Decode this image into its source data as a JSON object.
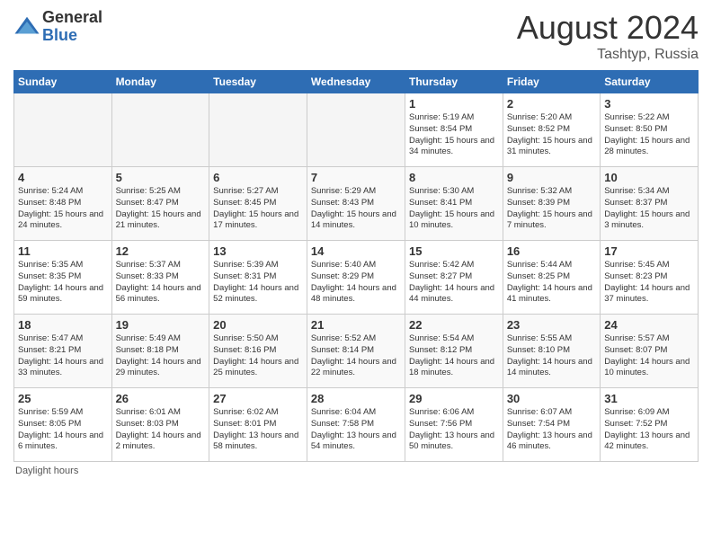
{
  "header": {
    "logo_general": "General",
    "logo_blue": "Blue",
    "month_title": "August 2024",
    "location": "Tashtyp, Russia"
  },
  "days_of_week": [
    "Sunday",
    "Monday",
    "Tuesday",
    "Wednesday",
    "Thursday",
    "Friday",
    "Saturday"
  ],
  "weeks": [
    [
      {
        "num": "",
        "empty": true
      },
      {
        "num": "",
        "empty": true
      },
      {
        "num": "",
        "empty": true
      },
      {
        "num": "",
        "empty": true
      },
      {
        "num": "1",
        "sunrise": "5:19 AM",
        "sunset": "8:54 PM",
        "daylight": "15 hours and 34 minutes."
      },
      {
        "num": "2",
        "sunrise": "5:20 AM",
        "sunset": "8:52 PM",
        "daylight": "15 hours and 31 minutes."
      },
      {
        "num": "3",
        "sunrise": "5:22 AM",
        "sunset": "8:50 PM",
        "daylight": "15 hours and 28 minutes."
      }
    ],
    [
      {
        "num": "4",
        "sunrise": "5:24 AM",
        "sunset": "8:48 PM",
        "daylight": "15 hours and 24 minutes."
      },
      {
        "num": "5",
        "sunrise": "5:25 AM",
        "sunset": "8:47 PM",
        "daylight": "15 hours and 21 minutes."
      },
      {
        "num": "6",
        "sunrise": "5:27 AM",
        "sunset": "8:45 PM",
        "daylight": "15 hours and 17 minutes."
      },
      {
        "num": "7",
        "sunrise": "5:29 AM",
        "sunset": "8:43 PM",
        "daylight": "15 hours and 14 minutes."
      },
      {
        "num": "8",
        "sunrise": "5:30 AM",
        "sunset": "8:41 PM",
        "daylight": "15 hours and 10 minutes."
      },
      {
        "num": "9",
        "sunrise": "5:32 AM",
        "sunset": "8:39 PM",
        "daylight": "15 hours and 7 minutes."
      },
      {
        "num": "10",
        "sunrise": "5:34 AM",
        "sunset": "8:37 PM",
        "daylight": "15 hours and 3 minutes."
      }
    ],
    [
      {
        "num": "11",
        "sunrise": "5:35 AM",
        "sunset": "8:35 PM",
        "daylight": "14 hours and 59 minutes."
      },
      {
        "num": "12",
        "sunrise": "5:37 AM",
        "sunset": "8:33 PM",
        "daylight": "14 hours and 56 minutes."
      },
      {
        "num": "13",
        "sunrise": "5:39 AM",
        "sunset": "8:31 PM",
        "daylight": "14 hours and 52 minutes."
      },
      {
        "num": "14",
        "sunrise": "5:40 AM",
        "sunset": "8:29 PM",
        "daylight": "14 hours and 48 minutes."
      },
      {
        "num": "15",
        "sunrise": "5:42 AM",
        "sunset": "8:27 PM",
        "daylight": "14 hours and 44 minutes."
      },
      {
        "num": "16",
        "sunrise": "5:44 AM",
        "sunset": "8:25 PM",
        "daylight": "14 hours and 41 minutes."
      },
      {
        "num": "17",
        "sunrise": "5:45 AM",
        "sunset": "8:23 PM",
        "daylight": "14 hours and 37 minutes."
      }
    ],
    [
      {
        "num": "18",
        "sunrise": "5:47 AM",
        "sunset": "8:21 PM",
        "daylight": "14 hours and 33 minutes."
      },
      {
        "num": "19",
        "sunrise": "5:49 AM",
        "sunset": "8:18 PM",
        "daylight": "14 hours and 29 minutes."
      },
      {
        "num": "20",
        "sunrise": "5:50 AM",
        "sunset": "8:16 PM",
        "daylight": "14 hours and 25 minutes."
      },
      {
        "num": "21",
        "sunrise": "5:52 AM",
        "sunset": "8:14 PM",
        "daylight": "14 hours and 22 minutes."
      },
      {
        "num": "22",
        "sunrise": "5:54 AM",
        "sunset": "8:12 PM",
        "daylight": "14 hours and 18 minutes."
      },
      {
        "num": "23",
        "sunrise": "5:55 AM",
        "sunset": "8:10 PM",
        "daylight": "14 hours and 14 minutes."
      },
      {
        "num": "24",
        "sunrise": "5:57 AM",
        "sunset": "8:07 PM",
        "daylight": "14 hours and 10 minutes."
      }
    ],
    [
      {
        "num": "25",
        "sunrise": "5:59 AM",
        "sunset": "8:05 PM",
        "daylight": "14 hours and 6 minutes."
      },
      {
        "num": "26",
        "sunrise": "6:01 AM",
        "sunset": "8:03 PM",
        "daylight": "14 hours and 2 minutes."
      },
      {
        "num": "27",
        "sunrise": "6:02 AM",
        "sunset": "8:01 PM",
        "daylight": "13 hours and 58 minutes."
      },
      {
        "num": "28",
        "sunrise": "6:04 AM",
        "sunset": "7:58 PM",
        "daylight": "13 hours and 54 minutes."
      },
      {
        "num": "29",
        "sunrise": "6:06 AM",
        "sunset": "7:56 PM",
        "daylight": "13 hours and 50 minutes."
      },
      {
        "num": "30",
        "sunrise": "6:07 AM",
        "sunset": "7:54 PM",
        "daylight": "13 hours and 46 minutes."
      },
      {
        "num": "31",
        "sunrise": "6:09 AM",
        "sunset": "7:52 PM",
        "daylight": "13 hours and 42 minutes."
      }
    ]
  ],
  "footer": {
    "daylight_note": "Daylight hours"
  }
}
